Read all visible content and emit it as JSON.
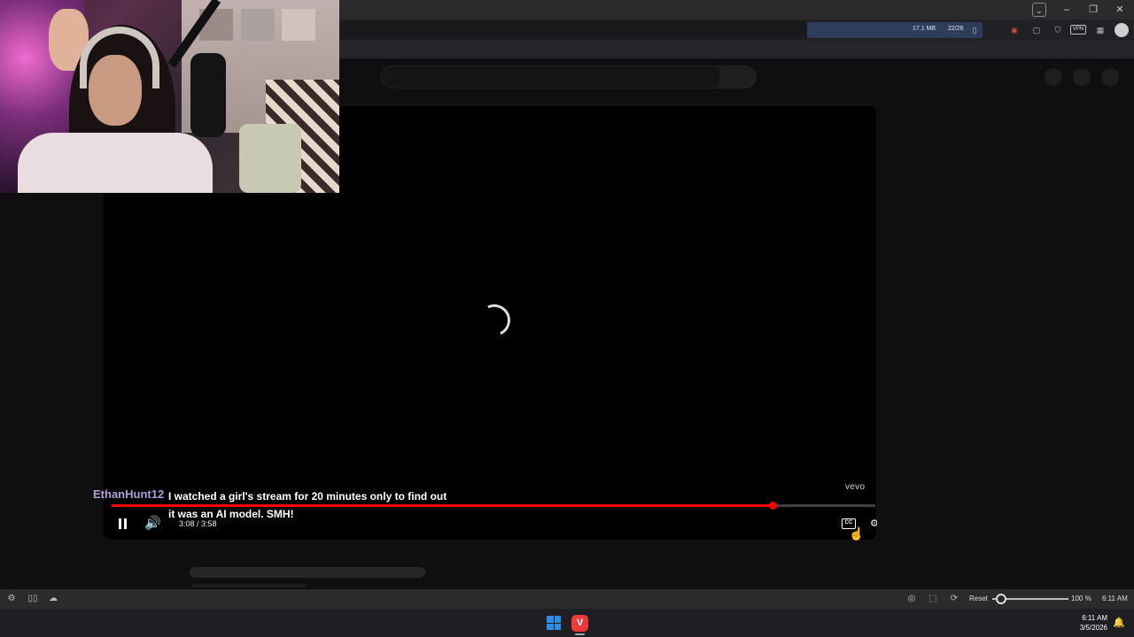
{
  "browser": {
    "memory": "17.1 MB",
    "tab_count": "22/26",
    "vpn_label": "VPN"
  },
  "player": {
    "watermark": "vevo",
    "time_display": "3:08 / 3:58",
    "progress_fraction": 0.866,
    "cc_label": "CC",
    "accent_color": "#ff0000"
  },
  "chat": {
    "username": "EthanHunt12",
    "username_color": "#b39ddb",
    "message": "I watched a girl's stream for 20 minutes only to find out it was an AI model. SMH!"
  },
  "statusbar": {
    "reset_label": "Reset",
    "zoom": "100 %",
    "zoom_fraction": 0.12,
    "clock": "6:11 AM"
  },
  "taskbar": {
    "time": "6:11 AM",
    "date": "3/5/2026"
  },
  "icons": {
    "window_controls": [
      "chevron-down-icon",
      "minimize-icon",
      "restore-icon",
      "close-icon"
    ],
    "extensions": [
      "camera-icon",
      "mouse-icon",
      "shield-icon",
      "vpn-icon",
      "calendar-icon",
      "avatar-icon"
    ]
  }
}
